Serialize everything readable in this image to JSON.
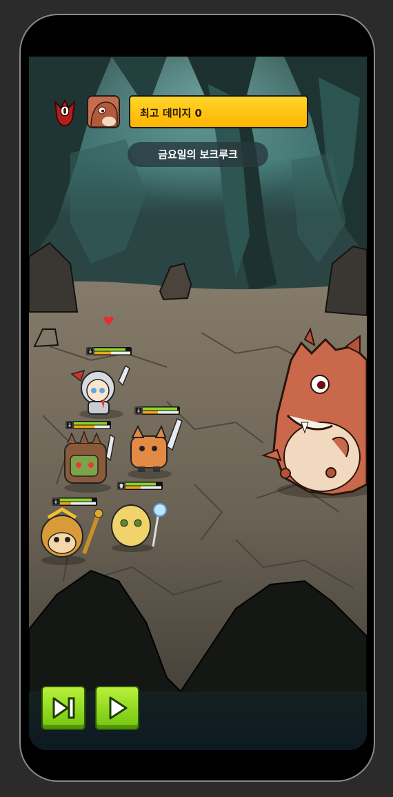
{
  "hud": {
    "kill_count": "0",
    "skull_icon": "skull-badge-icon",
    "boss_portrait_icon": "dinosaur-portrait-icon",
    "max_damage_label": "최고 데미지 0",
    "bar_color": "#ffc20e"
  },
  "boss": {
    "name": "금요일의 보크루크",
    "icon": "orange-dinosaur-boss"
  },
  "party": [
    {
      "name": "knight-hero",
      "icon": "silver-knight-girl",
      "hp_fraction": 0.85,
      "energy_fraction": 0.45,
      "status": "sword"
    },
    {
      "name": "tiger-warrior",
      "icon": "tiger-swordsman",
      "hp_fraction": 0.9,
      "energy_fraction": 0.4,
      "status": "sword"
    },
    {
      "name": "goblin-brute",
      "icon": "green-goblin",
      "hp_fraction": 0.88,
      "energy_fraction": 0.55,
      "status": "sword"
    },
    {
      "name": "frog-mage",
      "icon": "yellow-frog-staff",
      "hp_fraction": 0.8,
      "energy_fraction": 0.4,
      "status": "skull"
    },
    {
      "name": "monkey-king",
      "icon": "golden-monkey",
      "hp_fraction": 0.85,
      "energy_fraction": 0.3,
      "status": "sword"
    }
  ],
  "controls": {
    "skip_icon": "skip-forward-icon",
    "play_icon": "play-icon",
    "button_color": "#8ee01f"
  },
  "colors": {
    "hp_green": "#8bd42a",
    "energy_orange": "#f2a51a",
    "cave_teal": "#3f6f6c",
    "ground": "#6e6556"
  }
}
